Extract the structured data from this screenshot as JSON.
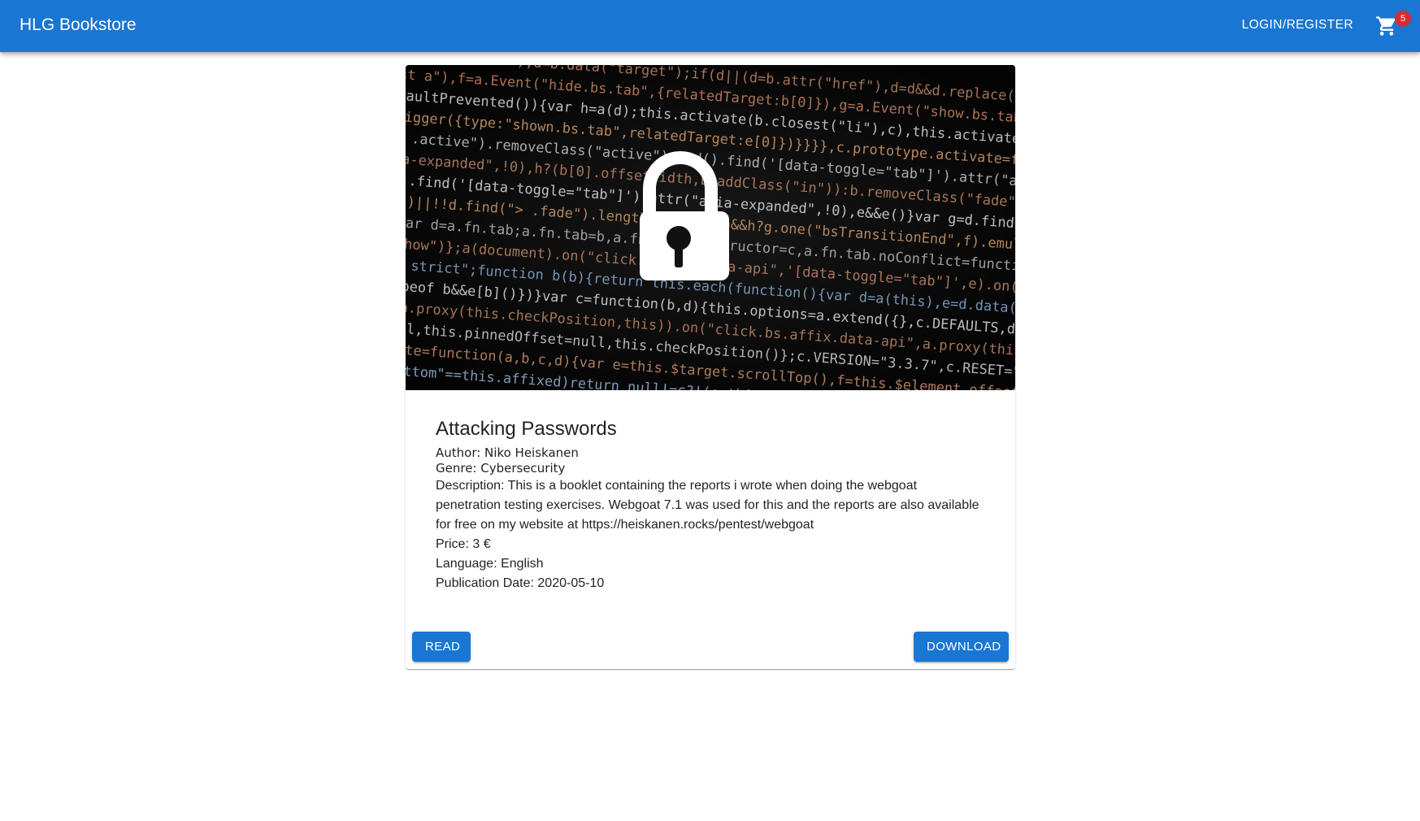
{
  "appbar": {
    "brand": "HLG Bookstore",
    "login_label": "LOGIN/REGISTER",
    "cart_icon": "shopping-cart-icon",
    "cart_count": "5",
    "color": "#1976d2",
    "badge_color": "#d32f2f"
  },
  "book": {
    "cover_icon": "padlock-icon",
    "title": "Attacking Passwords",
    "author": "Author: Niko Heiskanen",
    "genre": "Genre: Cybersecurity",
    "description": "Description: This is a booklet containing the reports i wrote when doing the webgoat penetration testing exercises. Webgoat 7.1 was used for this and the reports are also available for free on my website at https://heiskanen.rocks/pentest/webgoat",
    "price": "Price: 3 €",
    "language": "Language: English",
    "publication_date": "Publication Date: 2020-05-10"
  },
  "actions": {
    "read_label": "READ",
    "download_label": "DOWNLOAD"
  }
}
